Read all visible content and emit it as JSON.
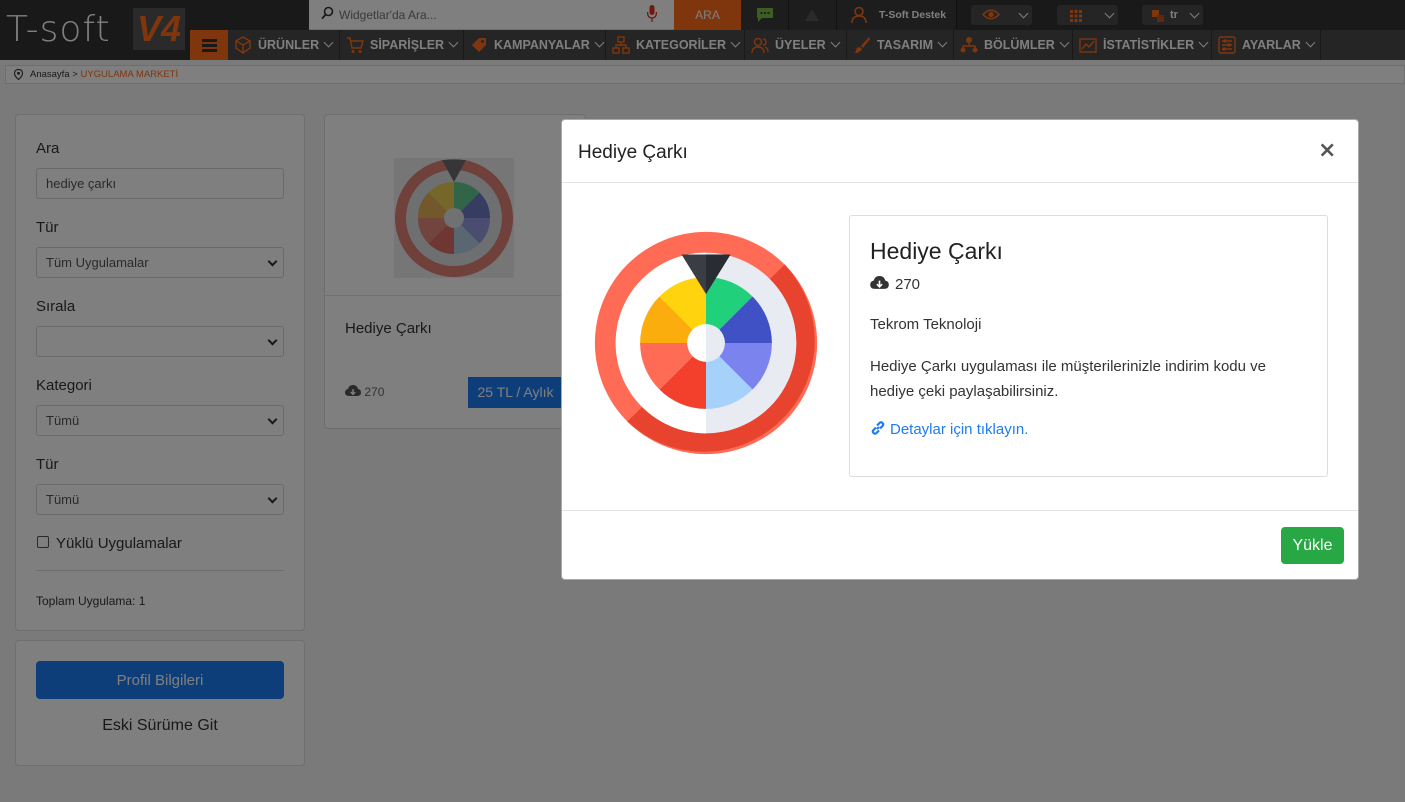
{
  "header": {
    "logo_text": "T-soft",
    "logo_version": "V4",
    "search_placeholder": "Widgetlar'da Ara...",
    "search_button": "ARA",
    "user_name": "T-Soft Destek",
    "lang": "tr",
    "accent_color": "#ff6c1a"
  },
  "nav": {
    "items": [
      {
        "label": "ÜRÜNLER",
        "icon": "box-icon"
      },
      {
        "label": "SİPARİŞLER",
        "icon": "cart-icon"
      },
      {
        "label": "KAMPANYALAR",
        "icon": "tag-icon"
      },
      {
        "label": "KATEGORİLER",
        "icon": "sitemap-icon"
      },
      {
        "label": "ÜYELER",
        "icon": "users-icon"
      },
      {
        "label": "TASARIM",
        "icon": "brush-icon"
      },
      {
        "label": "BÖLÜMLER",
        "icon": "hierarchy-icon"
      },
      {
        "label": "İSTATİSTİKLER",
        "icon": "chart-icon"
      },
      {
        "label": "AYARLAR",
        "icon": "settings-icon"
      }
    ]
  },
  "breadcrumb": {
    "home": "Anasayfa",
    "sep": ">",
    "current": "UYGULAMA MARKETİ"
  },
  "filters": {
    "search_label": "Ara",
    "search_value": "hediye çarkı",
    "type_label": "Tür",
    "type_value": "Tüm Uygulamalar",
    "sort_label": "Sırala",
    "sort_value": "",
    "category_label": "Kategori",
    "category_value": "Tümü",
    "type2_label": "Tür",
    "type2_value": "Tümü",
    "installed_label": "Yüklü Uygulamalar",
    "total": "Toplam Uygulama: 1"
  },
  "sidebar2": {
    "profile_button": "Profil Bilgileri",
    "old_version": "Eski Sürüme Git"
  },
  "card": {
    "title": "Hediye Çarkı",
    "downloads": "270",
    "price": "25 TL / Aylık"
  },
  "modal": {
    "title": "Hediye Çarkı",
    "close": "×",
    "name": "Hediye Çarkı",
    "downloads": "270",
    "company": "Tekrom Teknoloji",
    "description": "Hediye Çarkı uygulaması ile müşterilerinizle indirim kodu ve hediye çeki paylaşabilirsiniz.",
    "link": "Detaylar için tıklayın.",
    "install_button": "Yükle"
  }
}
